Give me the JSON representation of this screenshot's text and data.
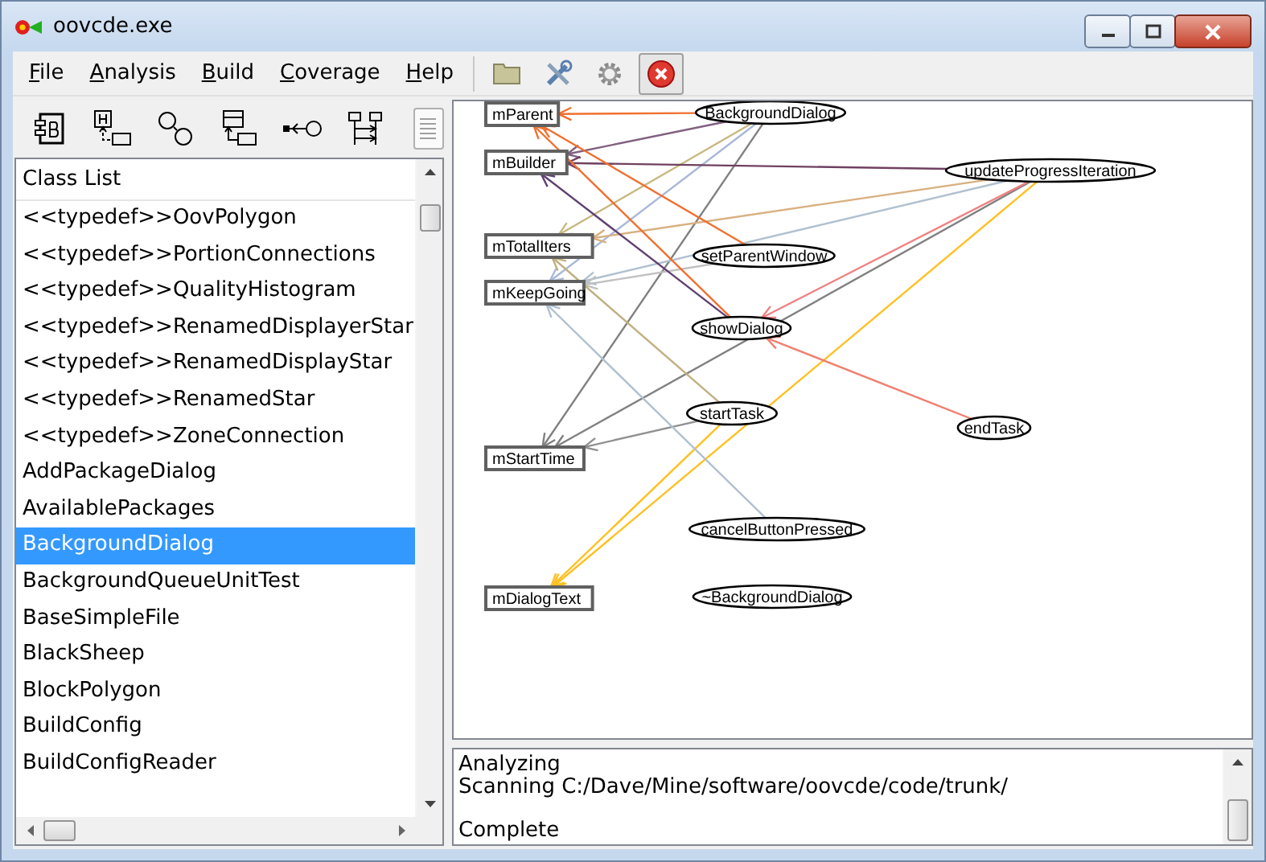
{
  "window": {
    "title": "oovcde.exe"
  },
  "menu": [
    {
      "label": "File"
    },
    {
      "label": "Analysis"
    },
    {
      "label": "Build"
    },
    {
      "label": "Coverage"
    },
    {
      "label": "Help"
    }
  ],
  "class_list": {
    "title": "Class List",
    "items": [
      {
        "label": "<<typedef>>OovPolygon",
        "selected": false
      },
      {
        "label": "<<typedef>>PortionConnections",
        "selected": false
      },
      {
        "label": "<<typedef>>QualityHistogram",
        "selected": false
      },
      {
        "label": "<<typedef>>RenamedDisplayerStar",
        "selected": false
      },
      {
        "label": "<<typedef>>RenamedDisplayStar",
        "selected": false
      },
      {
        "label": "<<typedef>>RenamedStar",
        "selected": false
      },
      {
        "label": "<<typedef>>ZoneConnection",
        "selected": false
      },
      {
        "label": "AddPackageDialog",
        "selected": false
      },
      {
        "label": "AvailablePackages",
        "selected": false
      },
      {
        "label": "BackgroundDialog",
        "selected": true
      },
      {
        "label": "BackgroundQueueUnitTest",
        "selected": false
      },
      {
        "label": "BaseSimpleFile",
        "selected": false
      },
      {
        "label": "BlackSheep",
        "selected": false
      },
      {
        "label": "BlockPolygon",
        "selected": false
      },
      {
        "label": "BuildConfig",
        "selected": false
      },
      {
        "label": "BuildConfigReader",
        "selected": false
      }
    ]
  },
  "diagram": {
    "nodes": [
      {
        "kind": "member",
        "label": "mParent"
      },
      {
        "kind": "member",
        "label": "mBuilder"
      },
      {
        "kind": "member",
        "label": "mTotalIters"
      },
      {
        "kind": "member",
        "label": "mKeepGoing"
      },
      {
        "kind": "member",
        "label": "mStartTime"
      },
      {
        "kind": "member",
        "label": "mDialogText"
      },
      {
        "kind": "method",
        "label": "BackgroundDialog"
      },
      {
        "kind": "method",
        "label": "updateProgressIteration"
      },
      {
        "kind": "method",
        "label": "setParentWindow"
      },
      {
        "kind": "method",
        "label": "showDialog"
      },
      {
        "kind": "method",
        "label": "startTask"
      },
      {
        "kind": "method",
        "label": "endTask"
      },
      {
        "kind": "method",
        "label": "cancelButtonPressed"
      },
      {
        "kind": "method",
        "label": "~BackgroundDialog"
      }
    ]
  },
  "output": {
    "paragraphs": [
      [
        "Analyzing",
        "Scanning C:/Dave/Mine/software/oovcde/code/trunk/"
      ],
      [
        "Complete"
      ]
    ]
  }
}
